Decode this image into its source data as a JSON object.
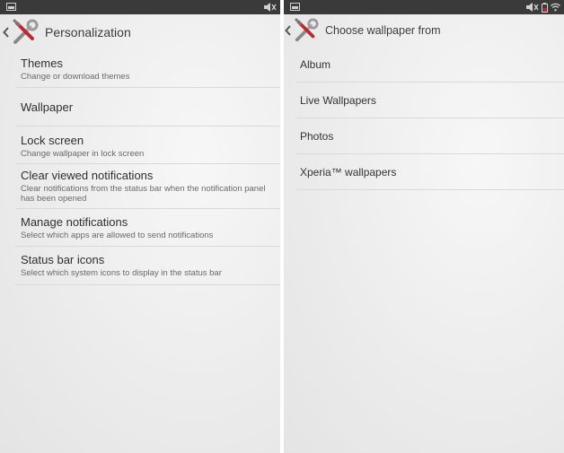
{
  "left": {
    "title": "Personalization",
    "items": [
      {
        "title": "Themes",
        "subtitle": "Change or download themes"
      },
      {
        "title": "Wallpaper",
        "subtitle": ""
      },
      {
        "title": "Lock screen",
        "subtitle": "Change wallpaper in lock screen"
      },
      {
        "title": "Clear viewed notifications",
        "subtitle": "Clear notifications from the status bar when the notification panel has been opened"
      },
      {
        "title": "Manage notifications",
        "subtitle": "Select which apps are allowed to send notifications"
      },
      {
        "title": "Status bar icons",
        "subtitle": "Select which system icons to display in the status bar"
      }
    ]
  },
  "right": {
    "title": "Choose wallpaper from",
    "items": [
      {
        "title": "Album"
      },
      {
        "title": "Live Wallpapers"
      },
      {
        "title": "Photos"
      },
      {
        "title": "Xperia™ wallpapers"
      }
    ]
  },
  "icons": {
    "statusbar_left": "screenshot-icon",
    "mute": "mute-icon",
    "battery": "battery-icon",
    "wifi": "wifi-icon",
    "back": "chevron-left-icon",
    "app": "wrench-screwdriver-icon"
  },
  "colors": {
    "statusbar": "#3a3a3a",
    "accent": "#c0272d",
    "divider": "#d9d9d9"
  }
}
